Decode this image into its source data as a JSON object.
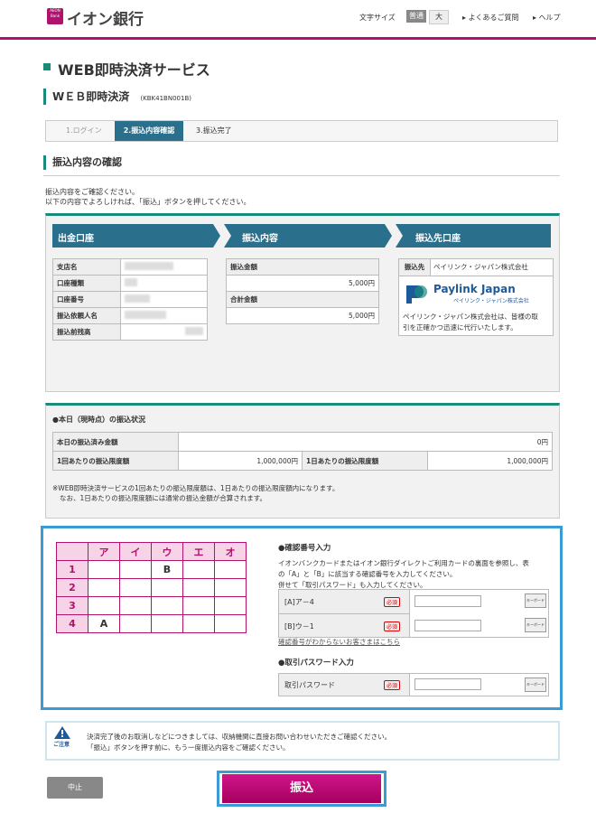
{
  "header": {
    "logo_mark": "AEON Bank",
    "logo_text": "イオン銀行",
    "font_size_label": "文字サイズ",
    "font_normal": "普通",
    "font_large": "大",
    "faq": "よくあるご質問",
    "help": "ヘルプ"
  },
  "page": {
    "title": "WEB即時決済サービス",
    "subtitle": "WＥＢ即時決済",
    "code": "(KBK41BN001B)"
  },
  "steps": [
    "1.ログイン",
    "2.振込内容確認",
    "3.振込完了"
  ],
  "confirm": {
    "title": "振込内容の確認",
    "note1": "振込内容をご確認ください。",
    "note2": "以下の内容でよろしければ、「振込」ボタンを押してください。"
  },
  "panels": {
    "source": {
      "title": "出金口座",
      "rows": [
        "支店名",
        "口座種類",
        "口座番号",
        "振込依頼人名",
        "振込前残高"
      ]
    },
    "content": {
      "title": "振込内容",
      "amount_label": "振込金額",
      "amount": "5,000円",
      "total_label": "合計金額",
      "total": "5,000円"
    },
    "dest": {
      "title": "振込先口座",
      "label": "振込先",
      "value": "ペイリンク・ジャパン株式会社",
      "brand": "Paylink Japan",
      "brand_sub": "ペイリンク・ジャパン株式会社",
      "desc1": "ペイリンク・ジャパン株式会社は、皆様の取",
      "desc2": "引を正確かつ迅速に代行いたします。"
    }
  },
  "status": {
    "title": "●本日（現時点）の振込状況",
    "done_label": "本日の振込済み金額",
    "done_value": "0円",
    "limit1_label": "1回あたりの振込限度額",
    "limit1_value": "1,000,000円",
    "limitd_label": "1日あたりの振込限度額",
    "limitd_value": "1,000,000円",
    "note1": "※WEB即時決済サービスの1回あたりの振込限度額は、1日あたりの振込限度額内になります。",
    "note2": "なお、1日あたりの振込限度額には通常の振込金額が合算されます。"
  },
  "grid": {
    "cols": [
      "ア",
      "イ",
      "ウ",
      "エ",
      "オ"
    ],
    "rows": [
      "1",
      "2",
      "3",
      "4"
    ],
    "mark_b": "B",
    "mark_a": "A"
  },
  "auth": {
    "confirm_title": "●確認番号入力",
    "desc1": "イオンバンクカードまたはイオン銀行ダイレクトご利用カードの裏面を参照し、表",
    "desc2": "の「A」と「B」に該当する確認番号を入力してください。",
    "desc3": "併せて「取引パスワード」も入力してください。",
    "a_label": "[A]ア－4",
    "b_label": "[B]ウ－1",
    "required": "必須",
    "keyboard": "キーボード",
    "help_link": "確認番号がわからないお客さまはこちら",
    "pw_title": "●取引パスワード入力",
    "pw_label": "取引パスワード"
  },
  "caution": {
    "label": "ご注意",
    "line1": "決済完了後のお取消しなどにつきましては、収納機関に直接お問い合わせいただきご確認ください。",
    "line2": "「振込」ボタンを押す前に、もう一度振込内容をご確認ください。"
  },
  "buttons": {
    "cancel": "中止",
    "submit": "振込"
  },
  "colors": {
    "brand": "#b0126e",
    "accent": "#1a8a7a",
    "panel_head": "#2a6f8c",
    "focus": "#3a9bd5"
  }
}
